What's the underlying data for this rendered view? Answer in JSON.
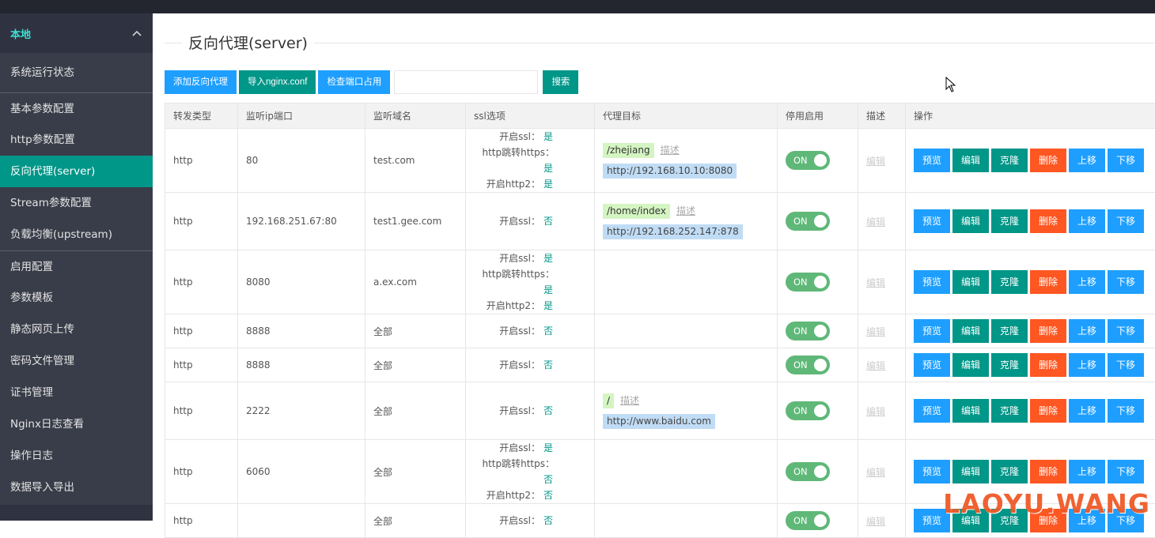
{
  "sidebar": {
    "group": "本地",
    "items": [
      {
        "label": "系统运行状态"
      },
      {
        "label": "基本参数配置"
      },
      {
        "label": "http参数配置"
      },
      {
        "label": "反向代理(server)"
      },
      {
        "label": "Stream参数配置"
      },
      {
        "label": "负载均衡(upstream)"
      },
      {
        "label": "启用配置"
      },
      {
        "label": "参数模板"
      },
      {
        "label": "静态网页上传"
      },
      {
        "label": "密码文件管理"
      },
      {
        "label": "证书管理"
      },
      {
        "label": "Nginx日志查看"
      },
      {
        "label": "操作日志"
      },
      {
        "label": "数据导入导出"
      }
    ]
  },
  "page": {
    "title": "反向代理(server)"
  },
  "toolbar": {
    "add": "添加反向代理",
    "import": "导入nginx.conf",
    "check": "检查端口占用",
    "search_value": "",
    "search": "搜索"
  },
  "table": {
    "headers": [
      "转发类型",
      "监听ip端口",
      "监听域名",
      "ssl选项",
      "代理目标",
      "停用启用",
      "描述",
      "操作"
    ],
    "ssl_labels": {
      "ssl": "开启ssl：",
      "redirect": "http跳转https：",
      "http2": "开启http2："
    },
    "target_desc": "描述",
    "toggle_label": "ON",
    "edit_desc": "编辑",
    "ops": {
      "preview": "预览",
      "edit": "编辑",
      "clone": "克隆",
      "delete": "删除",
      "up": "上移",
      "down": "下移"
    },
    "rows": [
      {
        "type": "http",
        "listen": "80",
        "domain": "test.com",
        "ssl": "是",
        "redirect": "是",
        "http2": "是",
        "path": "/zhejiang",
        "url": "http://192.168.10.10:8080"
      },
      {
        "type": "http",
        "listen": "192.168.251.67:80",
        "domain": "test1.gee.com",
        "ssl": "否",
        "path": "/home/index",
        "url": "http://192.168.252.147:878"
      },
      {
        "type": "http",
        "listen": "8080",
        "domain": "a.ex.com",
        "ssl": "是",
        "redirect": "是",
        "http2": "是"
      },
      {
        "type": "http",
        "listen": "8888",
        "domain": "全部",
        "ssl": "否"
      },
      {
        "type": "http",
        "listen": "8888",
        "domain": "全部",
        "ssl": "否"
      },
      {
        "type": "http",
        "listen": "2222",
        "domain": "全部",
        "ssl": "否",
        "path": "/",
        "url": "http://www.baidu.com"
      },
      {
        "type": "http",
        "listen": "6060",
        "domain": "全部",
        "ssl": "是",
        "redirect": "否",
        "http2": "否"
      },
      {
        "type": "http",
        "listen": "",
        "domain": "全部",
        "ssl": "否"
      }
    ]
  },
  "watermark": "LAOYU.WANG"
}
